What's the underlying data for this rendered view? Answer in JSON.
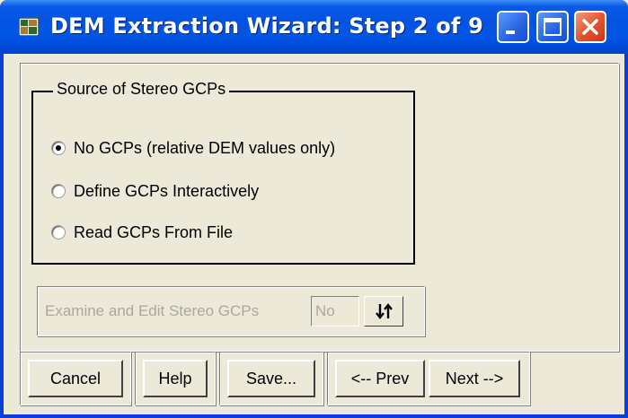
{
  "window": {
    "title": "DEM Extraction Wizard: Step 2 of 9",
    "app_icon": "dem-app-icon",
    "controls": [
      "minimize-icon",
      "maximize-icon",
      "close-icon"
    ]
  },
  "source_group": {
    "legend": "Source of Stereo GCPs",
    "options": [
      {
        "label": "No GCPs (relative DEM values only)",
        "selected": true
      },
      {
        "label": "Define GCPs Interactively",
        "selected": false
      },
      {
        "label": "Read GCPs From File",
        "selected": false
      }
    ]
  },
  "examine": {
    "label": "Examine and Edit Stereo GCPs",
    "value": "No",
    "toggle_icon": "up-down-arrows-icon",
    "disabled": true
  },
  "buttons": {
    "cancel": "Cancel",
    "help": "Help",
    "save": "Save...",
    "prev": "<-- Prev",
    "next": "Next -->"
  },
  "colors": {
    "titlebar": "#0055e5",
    "face": "#ece9d8",
    "disabled_text": "#aca899",
    "close_button": "#e0532c"
  }
}
